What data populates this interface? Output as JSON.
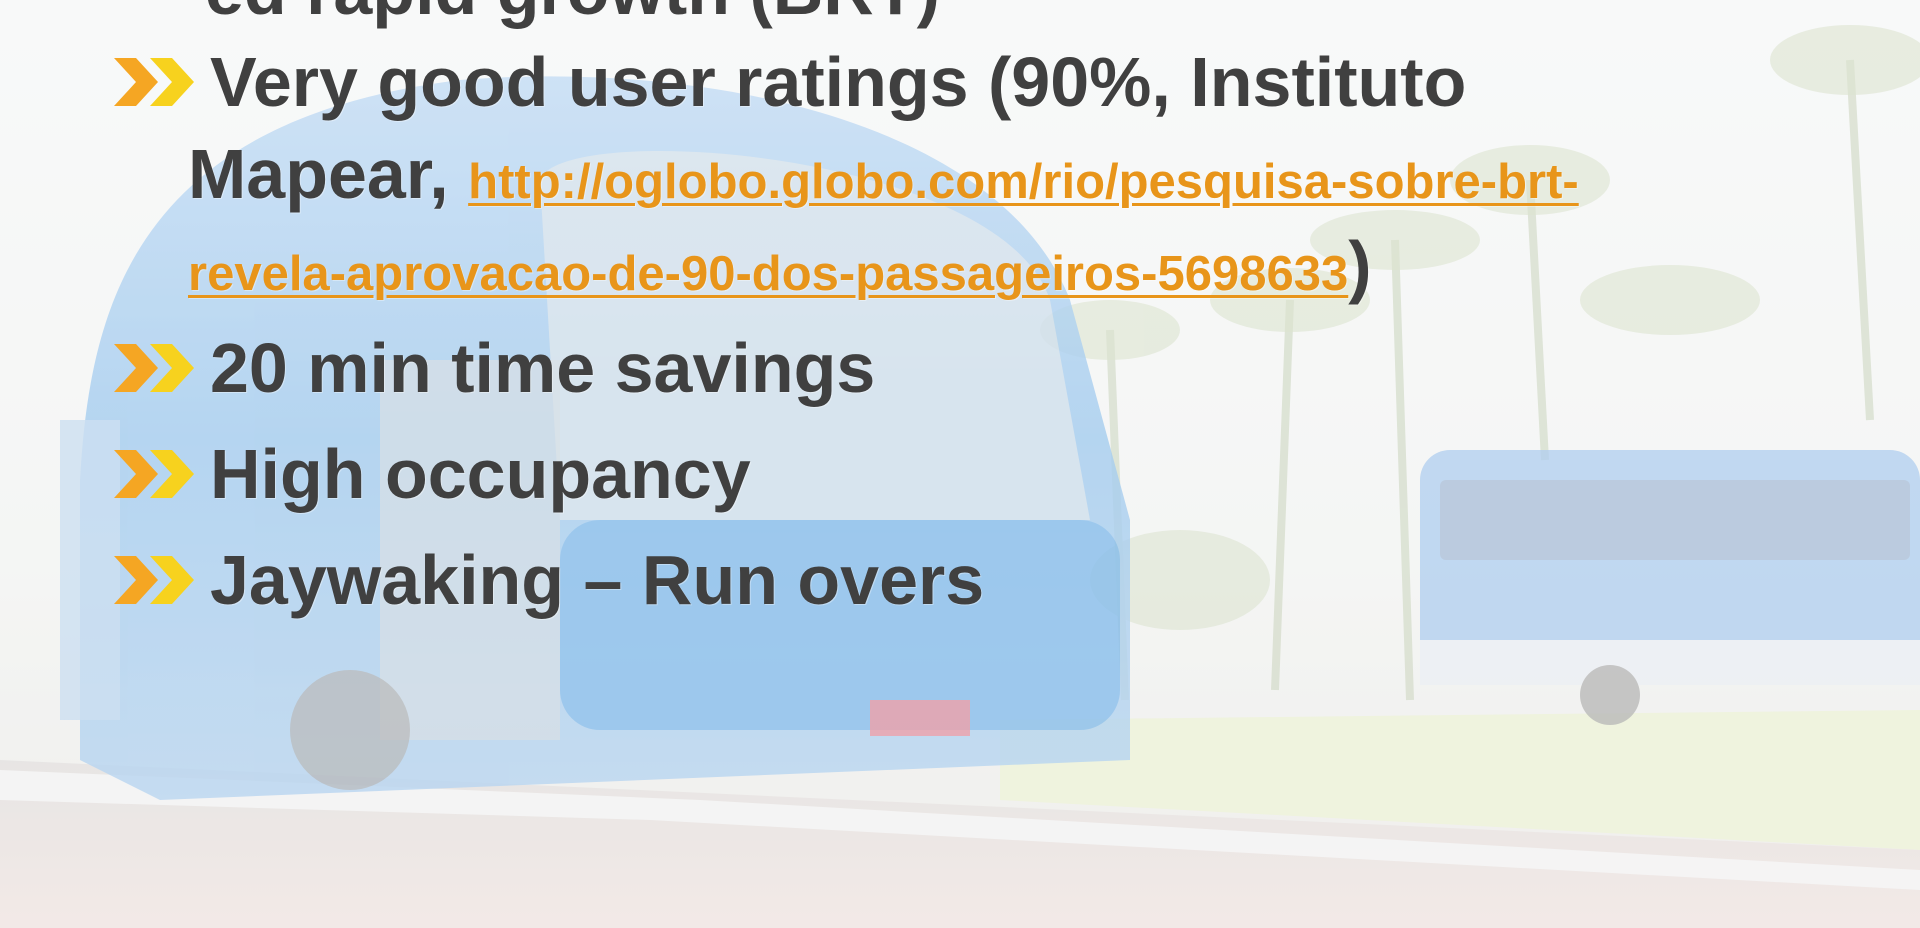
{
  "slide": {
    "partial_top_line": "ed rapid growth (BRT)",
    "bullets": [
      {
        "text_before_link": "Very good user ratings (90%, Instituto",
        "text_line2": "Mapear, ",
        "link_part1": "http://oglobo.globo.com/rio/pesquisa-sobre-brt-",
        "link_part2": "revela-aprovacao-de-90-dos-passageiros-5698633",
        "closing": ")"
      },
      {
        "text": "20 min time savings"
      },
      {
        "text": "High occupancy"
      },
      {
        "text": "Jaywaking – Run overs"
      }
    ],
    "icons": {
      "bullet": "double-chevron-icon"
    },
    "colors": {
      "text": "#404040",
      "link": "#E8951A",
      "chevron_left": "#F5A623",
      "chevron_right": "#F7D21E"
    }
  }
}
